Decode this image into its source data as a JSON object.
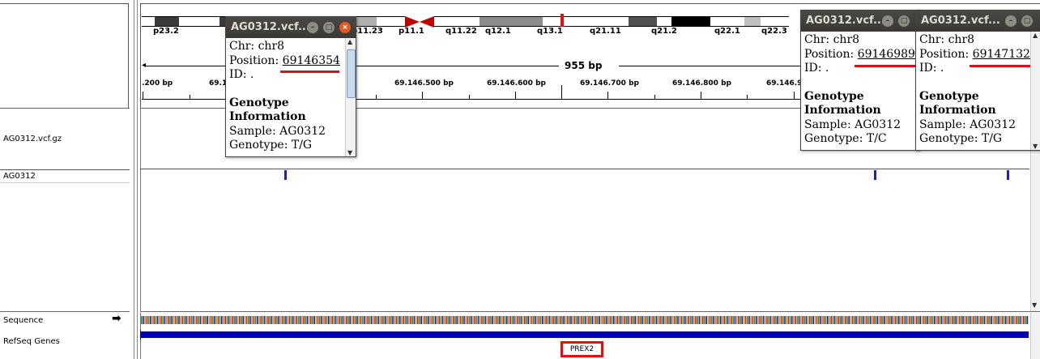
{
  "ideogram": {
    "bands": [
      {
        "label": "p23.2",
        "color": "#ffffff"
      },
      {
        "label": "p11.23",
        "color": "#ffffff"
      },
      {
        "label": "p11.1",
        "color": "#c00000"
      },
      {
        "label": "q11.22",
        "color": "#ffffff"
      },
      {
        "label": "q12.1",
        "color": "#8c8c8c"
      },
      {
        "label": "q13.1",
        "color": "#ffffff"
      },
      {
        "label": "q21.11",
        "color": "#ffffff"
      },
      {
        "label": "q21.2",
        "color": "#404040"
      },
      {
        "label": "q22.1",
        "color": "#ffffff"
      },
      {
        "label": "q22.3",
        "color": "#ffffff"
      }
    ]
  },
  "ruler": {
    "span_label": "955 bp",
    "ticks": [
      ".200 bp",
      "69.1",
      "69.146.500 bp",
      "69.146.600 bp",
      "69.146.700 bp",
      "69.146.800 bp",
      "69.146.9"
    ]
  },
  "tracks": {
    "vcf_label": "AG0312.vcf.gz",
    "sample_label": "AG0312",
    "sequence_label": "Sequence",
    "refseq_label": "RefSeq Genes",
    "gene_name": "PREX2"
  },
  "popups": [
    {
      "title": "AG0312.vcf...",
      "chr": "Chr: chr8",
      "position_label": "Position: ",
      "position": "69146354",
      "id": "ID: .",
      "section": "Genotype Information",
      "sample": "Sample: AG0312",
      "genotype": "Genotype: T/G"
    },
    {
      "title": "AG0312.vcf...",
      "chr": "Chr: chr8",
      "position_label": "Position: ",
      "position": "69146989",
      "id": "ID: .",
      "section": "Genotype Information",
      "sample": "Sample: AG0312",
      "genotype": "Genotype: T/C"
    },
    {
      "title": "AG0312.vcf...",
      "chr": "Chr: chr8",
      "position_label": "Position: ",
      "position": "69147132",
      "id": "ID: .",
      "section": "Genotype Information",
      "sample": "Sample: AG0312",
      "genotype": "Genotype: T/G"
    }
  ],
  "colors": {
    "variant": "#1d1dd6",
    "gene": "#0000b3",
    "highlight": "#e01010"
  }
}
